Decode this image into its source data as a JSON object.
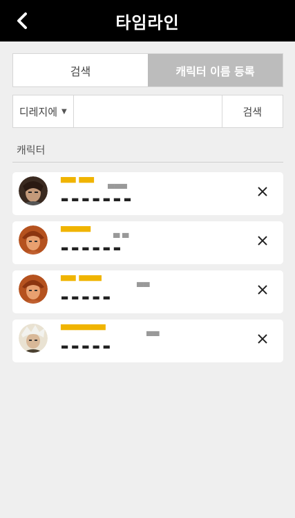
{
  "header": {
    "title": "타임라인",
    "back_icon": "chevron-left-icon"
  },
  "tabs": [
    {
      "label": "검색",
      "active": false
    },
    {
      "label": "캐릭터 이름 등록",
      "active": true
    }
  ],
  "search": {
    "server_selected": "디레지에",
    "server_caret": "▼",
    "placeholder": "",
    "button_label": "검색"
  },
  "section": {
    "label": "캐릭터"
  },
  "characters": [
    {
      "name": "▀▀ ▀▀",
      "level": "▄▄▄",
      "meta": "▬ ▬ ▬ ▬ ▬ ▬ ▬",
      "avatar_colors": [
        "#3a2a20",
        "#c49a7a"
      ]
    },
    {
      "name": "▀▀▀▀",
      "level": "▄ ▄",
      "meta": "▬ ▬ ▬ ▬ ▬ ▬",
      "avatar_colors": [
        "#b5521f",
        "#e8a070"
      ]
    },
    {
      "name": "▀▀ ▀▀▀",
      "level": "▄▄",
      "meta": "▬ ▬ ▬ ▬ ▬",
      "avatar_colors": [
        "#b5521f",
        "#e8a070"
      ]
    },
    {
      "name": "▀▀▀▀▀▀",
      "level": "▄▄",
      "meta": "▬ ▬ ▬ ▬ ▬",
      "avatar_colors": [
        "#4a4030",
        "#e9e2d2"
      ]
    }
  ],
  "colors": {
    "header_bg": "#000000",
    "active_tab_bg": "#bcbcbc",
    "name_color": "#f0b400",
    "page_bg": "#efefef"
  }
}
